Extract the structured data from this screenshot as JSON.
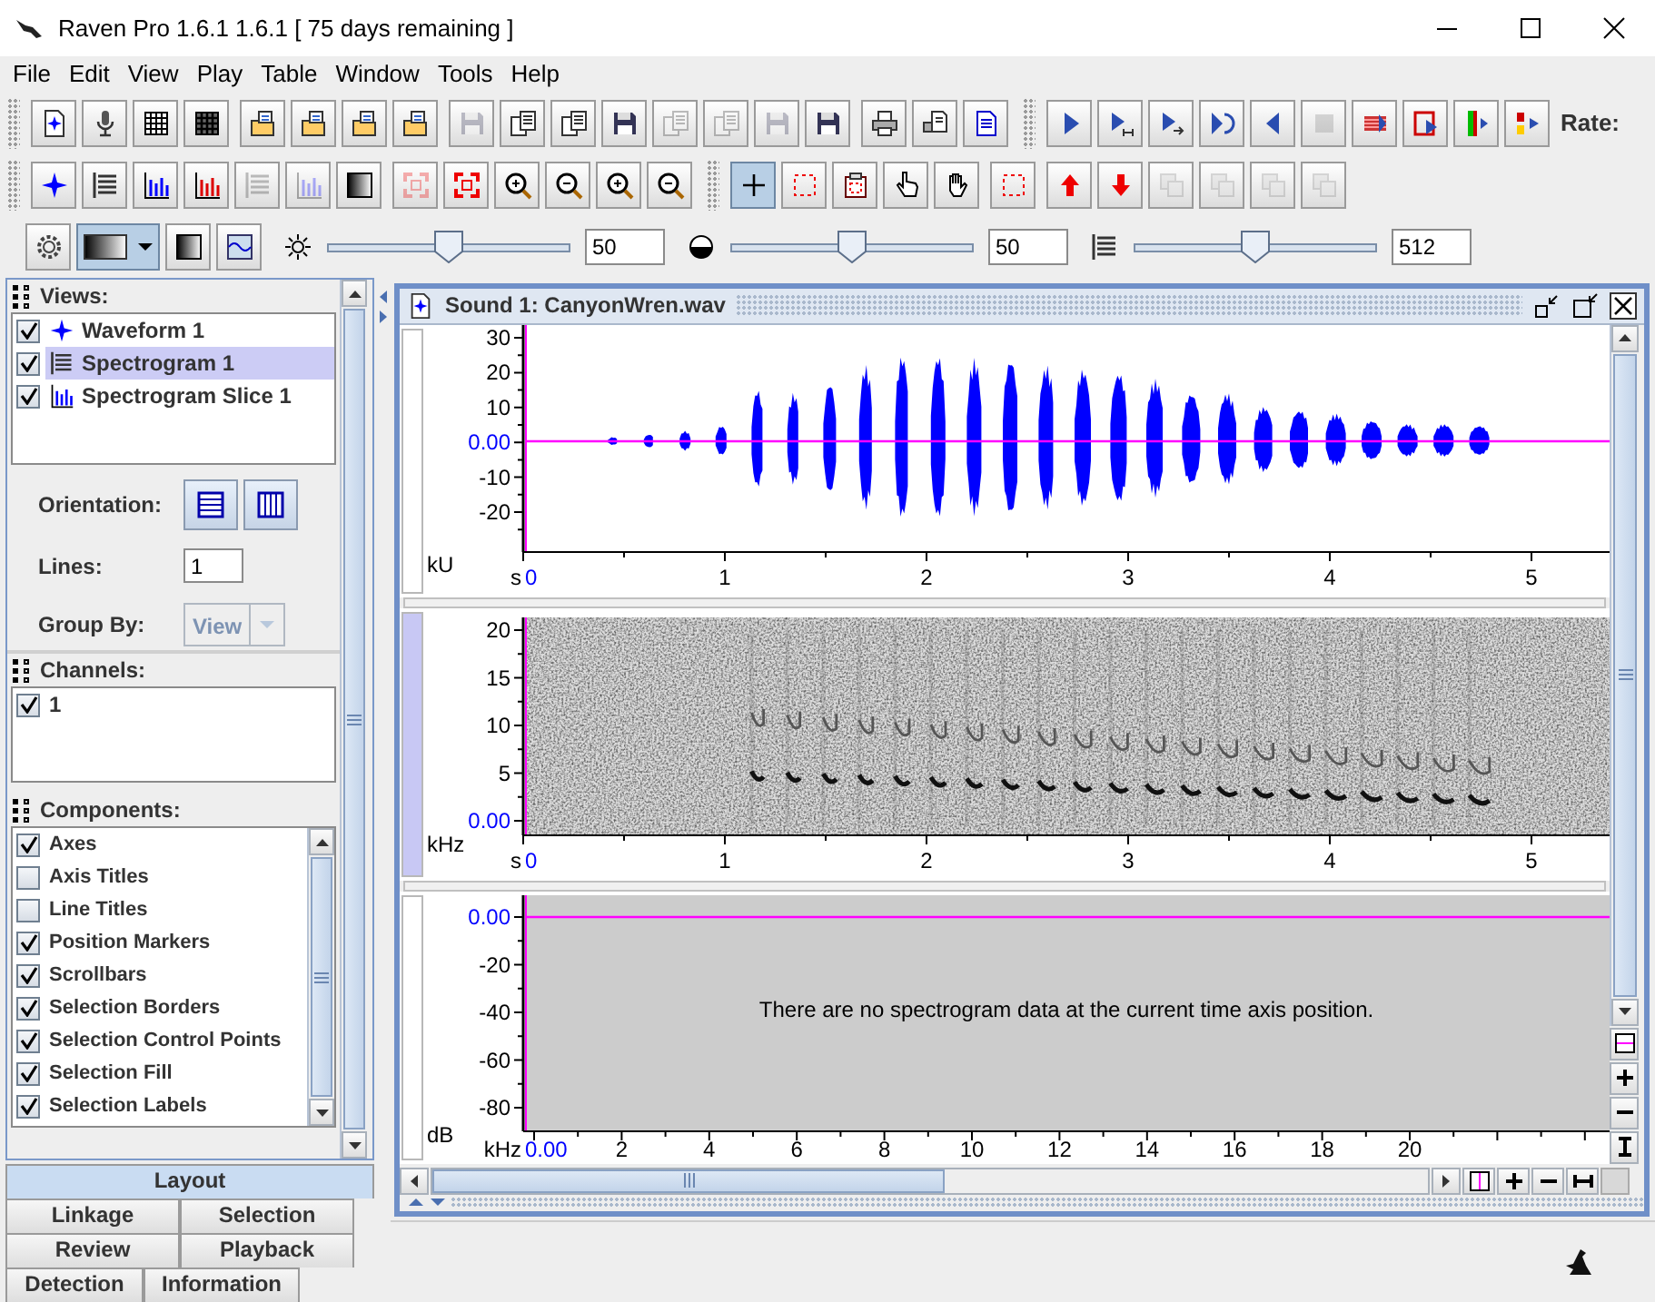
{
  "window": {
    "title": "Raven Pro 1.6.1 1.6.1  [ 75 days remaining ]"
  },
  "menu": [
    "File",
    "Edit",
    "View",
    "Play",
    "Table",
    "Window",
    "Tools",
    "Help"
  ],
  "toolbar_rows": [
    [
      {
        "groups": [
          [
            {
              "kind": "document-star",
              "disabled": false
            },
            {
              "kind": "microphone",
              "disabled": false
            },
            {
              "kind": "grid",
              "disabled": false
            },
            {
              "kind": "grid-dark",
              "disabled": false
            }
          ],
          [
            {
              "kind": "folder-document",
              "disabled": false
            },
            {
              "kind": "folder-document",
              "disabled": false
            },
            {
              "kind": "folder-document",
              "disabled": false
            },
            {
              "kind": "folder-document",
              "disabled": false
            }
          ],
          [
            {
              "kind": "floppy-disk",
              "disabled": true
            },
            {
              "kind": "documents-stack",
              "disabled": false
            },
            {
              "kind": "documents-stack",
              "disabled": false
            },
            {
              "kind": "floppy-disk",
              "disabled": false
            },
            {
              "kind": "documents-stack",
              "disabled": true
            },
            {
              "kind": "documents-stack",
              "disabled": true
            },
            {
              "kind": "floppy-disk",
              "disabled": true
            },
            {
              "kind": "floppy-disk",
              "disabled": false
            }
          ],
          [
            {
              "kind": "printer",
              "disabled": false
            },
            {
              "kind": "printer-document",
              "disabled": false
            },
            {
              "kind": "page-lines",
              "disabled": false
            }
          ]
        ]
      },
      {
        "groups": [
          [
            {
              "kind": "play-triangle",
              "disabled": false
            },
            {
              "kind": "play-bracket",
              "disabled": false
            },
            {
              "kind": "play-arrow",
              "disabled": false
            },
            {
              "kind": "loop-arrow",
              "disabled": false
            },
            {
              "kind": "reverse-triangle",
              "disabled": false
            },
            {
              "kind": "stop-square",
              "disabled": true
            },
            {
              "kind": "red-stripes",
              "disabled": false
            },
            {
              "kind": "red-frame",
              "disabled": false
            },
            {
              "kind": "green-bar",
              "disabled": false
            },
            {
              "kind": "color-bars",
              "disabled": false
            }
          ]
        ],
        "label": "Rate:"
      }
    ],
    [
      {
        "groups": [
          [
            {
              "kind": "star-waveform",
              "disabled": false
            },
            {
              "kind": "lines",
              "disabled": false
            },
            {
              "kind": "bar-chart",
              "disabled": false
            },
            {
              "kind": "bar-chart-red",
              "disabled": false
            },
            {
              "kind": "lines",
              "disabled": true
            },
            {
              "kind": "bar-chart",
              "disabled": true
            },
            {
              "kind": "gradient-square",
              "disabled": false
            }
          ],
          [
            {
              "kind": "red-corners",
              "disabled": true
            },
            {
              "kind": "red-corners",
              "disabled": false
            },
            {
              "kind": "zoom-in",
              "disabled": false
            },
            {
              "kind": "zoom-out",
              "disabled": false
            },
            {
              "kind": "zoom-in",
              "disabled": false
            },
            {
              "kind": "zoom-out",
              "disabled": false
            }
          ]
        ]
      },
      {
        "groups": [
          [
            {
              "kind": "crosshair",
              "disabled": false,
              "selected": true
            },
            {
              "kind": "dashed-frame",
              "disabled": false,
              "selected": false
            },
            {
              "kind": "clipboard",
              "disabled": false,
              "selected": false
            },
            {
              "kind": "hand-pointer",
              "disabled": false,
              "selected": false
            },
            {
              "kind": "hand",
              "disabled": false,
              "selected": false
            }
          ],
          [
            {
              "kind": "dashed-frame",
              "disabled": false
            }
          ],
          [
            {
              "kind": "up-arrow",
              "disabled": false
            },
            {
              "kind": "down-arrow",
              "disabled": false
            },
            {
              "kind": "stacked-squares",
              "disabled": true
            },
            {
              "kind": "stacked-squares",
              "disabled": true
            },
            {
              "kind": "stacked-squares",
              "disabled": true
            },
            {
              "kind": "stacked-squares",
              "disabled": true
            }
          ]
        ]
      }
    ]
  ],
  "display_toolbar": {
    "buttons": [
      {
        "kind": "gear"
      },
      {
        "kind": "colormap-combo"
      },
      {
        "kind": "gradient-square"
      },
      {
        "kind": "wave-image"
      }
    ],
    "sliders": [
      {
        "kind": "sun",
        "level": 0.5,
        "value": "50"
      },
      {
        "kind": "half-circle",
        "level": 0.5,
        "value": "50"
      },
      {
        "kind": "level-lines",
        "level": 0.5,
        "value": "512"
      }
    ]
  },
  "views": {
    "title": "Views:",
    "items": [
      {
        "kind": "star-waveform",
        "label": "Waveform 1",
        "checked": true,
        "selected": false
      },
      {
        "kind": "lines",
        "label": "Spectrogram 1",
        "checked": true,
        "selected": true
      },
      {
        "kind": "bar-chart",
        "label": "Spectrogram Slice 1",
        "checked": true,
        "selected": false
      }
    ]
  },
  "layout": {
    "orientation_label": "Orientation:",
    "lines_label": "Lines:",
    "lines_value": "1",
    "group_by_label": "Group By:",
    "group_by": {
      "value": "View",
      "disabled": true
    }
  },
  "channels": {
    "title": "Channels:",
    "items": [
      {
        "label": "1",
        "checked": true
      }
    ]
  },
  "components": {
    "title": "Components:",
    "items": [
      {
        "label": "Axes",
        "checked": true
      },
      {
        "label": "Axis Titles",
        "checked": false
      },
      {
        "label": "Line Titles",
        "checked": false
      },
      {
        "label": "Position Markers",
        "checked": true
      },
      {
        "label": "Scrollbars",
        "checked": true
      },
      {
        "label": "Selection Borders",
        "checked": true
      },
      {
        "label": "Selection Control Points",
        "checked": true
      },
      {
        "label": "Selection Fill",
        "checked": true
      },
      {
        "label": "Selection Labels",
        "checked": true
      }
    ]
  },
  "tab_rows": [
    [
      {
        "label": "Layout",
        "selected": true
      }
    ],
    [
      {
        "label": "Linkage",
        "selected": false
      },
      {
        "label": "Selection",
        "selected": false
      }
    ],
    [
      {
        "label": "Review",
        "selected": false
      },
      {
        "label": "Playback",
        "selected": false
      }
    ],
    [
      {
        "label": "Detection",
        "selected": false
      },
      {
        "label": "Information",
        "selected": false
      }
    ]
  ],
  "sound_window": {
    "title": "Sound 1: CanyonWren.wav",
    "views": [
      {
        "kind": "waveform",
        "selected": false,
        "y_unit": "kU",
        "y_ticks": [
          {
            "label": "30",
            "origin": false
          },
          {
            "label": "20",
            "origin": false
          },
          {
            "label": "10",
            "origin": false
          },
          {
            "label": "0.00",
            "origin": true
          },
          {
            "label": "-10",
            "origin": false
          },
          {
            "label": "-20",
            "origin": false
          }
        ],
        "x_unit": "s",
        "x_ticks": [
          {
            "label": "0",
            "origin": true
          },
          {
            "label": "1",
            "origin": false
          },
          {
            "label": "2",
            "origin": false
          },
          {
            "label": "3",
            "origin": false
          },
          {
            "label": "4",
            "origin": false
          },
          {
            "label": "5",
            "origin": false
          }
        ]
      },
      {
        "kind": "spectrogram",
        "selected": true,
        "y_unit": "kHz",
        "y_ticks": [
          {
            "label": "20",
            "origin": false
          },
          {
            "label": "15",
            "origin": false
          },
          {
            "label": "10",
            "origin": false
          },
          {
            "label": "5",
            "origin": false
          },
          {
            "label": "0.00",
            "origin": true
          }
        ],
        "x_unit": "s",
        "x_ticks": [
          {
            "label": "0",
            "origin": true
          },
          {
            "label": "1",
            "origin": false
          },
          {
            "label": "2",
            "origin": false
          },
          {
            "label": "3",
            "origin": false
          },
          {
            "label": "4",
            "origin": false
          },
          {
            "label": "5",
            "origin": false
          }
        ]
      },
      {
        "kind": "slice",
        "selected": false,
        "y_unit": "dB",
        "y_ticks": [
          {
            "label": "0.00",
            "origin": true
          },
          {
            "label": "-20",
            "origin": false
          },
          {
            "label": "-40",
            "origin": false
          },
          {
            "label": "-60",
            "origin": false
          },
          {
            "label": "-80",
            "origin": false
          }
        ],
        "x_unit": "kHz",
        "x_ticks": [
          {
            "label": "0.00",
            "origin": true
          },
          {
            "label": "2",
            "origin": false
          },
          {
            "label": "4",
            "origin": false
          },
          {
            "label": "6",
            "origin": false
          },
          {
            "label": "8",
            "origin": false
          },
          {
            "label": "10",
            "origin": false
          },
          {
            "label": "12",
            "origin": false
          },
          {
            "label": "14",
            "origin": false
          },
          {
            "label": "16",
            "origin": false
          },
          {
            "label": "18",
            "origin": false
          },
          {
            "label": "20",
            "origin": false
          }
        ],
        "message": "There are no spectrogram data at the current time axis position."
      }
    ]
  }
}
